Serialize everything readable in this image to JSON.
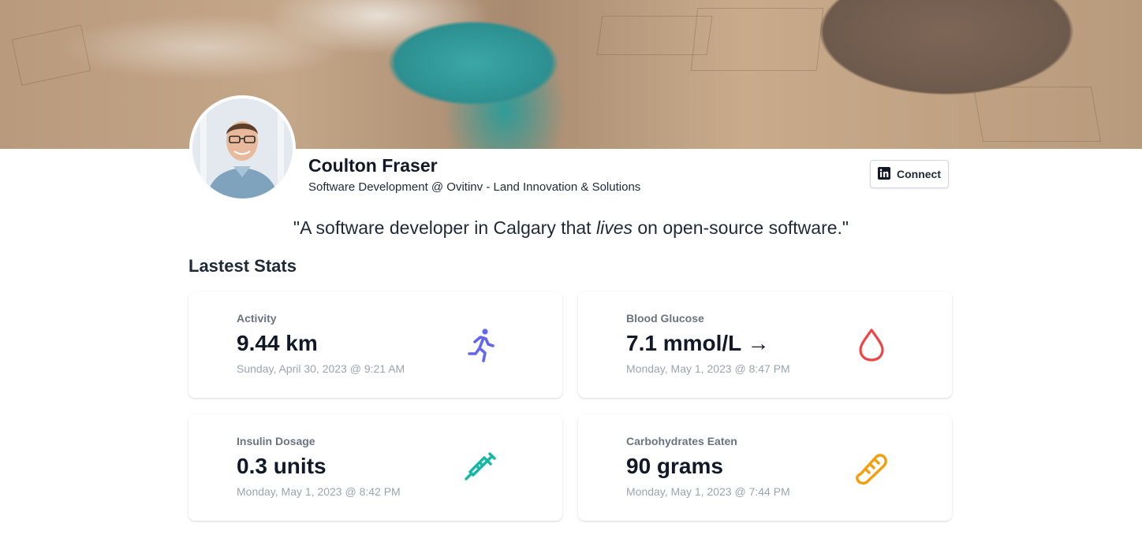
{
  "profile": {
    "name": "Coulton Fraser",
    "headline": "Software Development @ Ovitinv - Land Innovation & Solutions",
    "connect_label": "Connect"
  },
  "quote": {
    "before": "\"A software developer in Calgary that ",
    "emphasis": "lives",
    "after": " on open-source software.\""
  },
  "stats": {
    "title": "Lastest Stats",
    "cards": [
      {
        "label": "Activity",
        "value": "9.44 km",
        "time": "Sunday, April 30, 2023 @ 9:21 AM",
        "icon": "running-icon",
        "color": "#6366f1"
      },
      {
        "label": "Blood Glucose",
        "value": "7.1 mmol/L →",
        "time": "Monday, May 1, 2023 @ 8:47 PM",
        "icon": "droplet-icon",
        "color": "#ef4444"
      },
      {
        "label": "Insulin Dosage",
        "value": "0.3 units",
        "time": "Monday, May 1, 2023 @ 8:42 PM",
        "icon": "syringe-icon",
        "color": "#14b8a6"
      },
      {
        "label": "Carbohydrates Eaten",
        "value": "90 grams",
        "time": "Monday, May 1, 2023 @ 7:44 PM",
        "icon": "bread-icon",
        "color": "#f59e0b"
      }
    ]
  }
}
